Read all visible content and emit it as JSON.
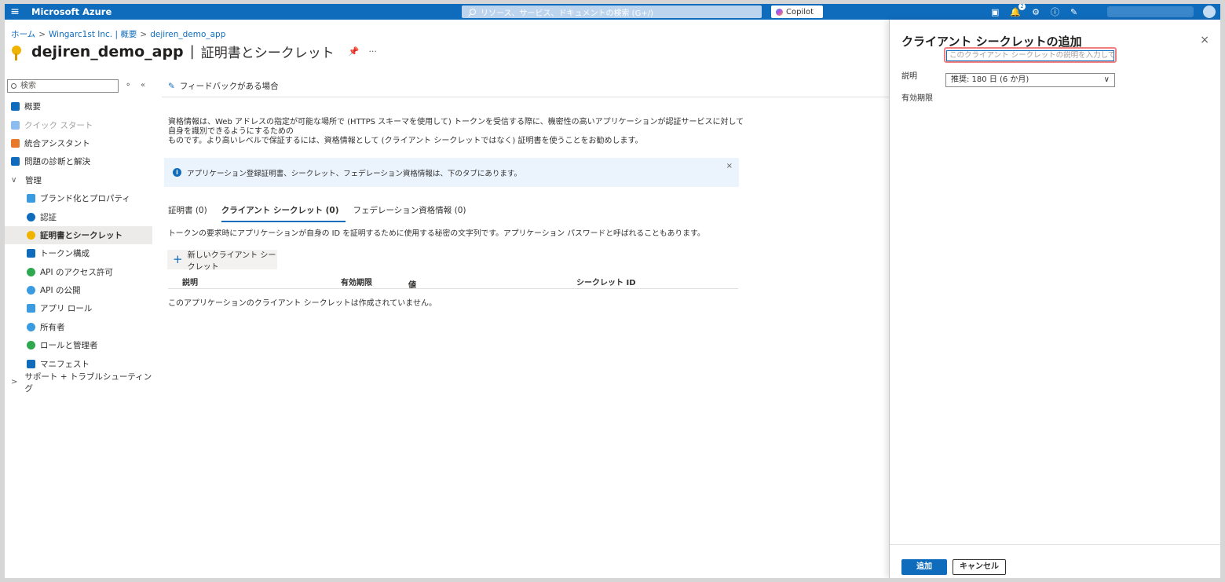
{
  "topbar": {
    "menu_icon": "hamburger-icon",
    "brand": "Microsoft Azure",
    "search_placeholder": "リソース、サービス、ドキュメントの検索 (G+/)",
    "copilot_label": "Copilot",
    "notification_count": "2"
  },
  "breadcrumb": {
    "home": "ホーム",
    "org": "Wingarc1st Inc. | 概要",
    "app": "dejiren_demo_app"
  },
  "title": {
    "app_name": "dejiren_demo_app",
    "separator": "|",
    "page": "証明書とシークレット",
    "more": "···"
  },
  "sidebar": {
    "search_placeholder": "検索",
    "items": [
      {
        "label": "概要",
        "icon": "overview-icon",
        "color": "#0f6cbd"
      },
      {
        "label": "クイック スタート",
        "icon": "quickstart-icon",
        "color": "#8cbdf0"
      },
      {
        "label": "統合アシスタント",
        "icon": "rocket-icon",
        "color": "#e8792b"
      },
      {
        "label": "問題の診断と解決",
        "icon": "wrench-icon",
        "color": "#0f6cbd"
      },
      {
        "label": "管理",
        "icon": "chevron-down-icon"
      },
      {
        "label": "ブランド化とプロパティ",
        "icon": "branding-icon",
        "color": "#3a9be0"
      },
      {
        "label": "認証",
        "icon": "auth-icon",
        "color": "#0f6cbd"
      },
      {
        "label": "証明書とシークレット",
        "icon": "key-icon",
        "color": "#f0b400"
      },
      {
        "label": "トークン構成",
        "icon": "token-icon",
        "color": "#0f6cbd"
      },
      {
        "label": "API のアクセス許可",
        "icon": "api-permission-icon",
        "color": "#2fa84f"
      },
      {
        "label": "API の公開",
        "icon": "cloud-icon",
        "color": "#3a9be0"
      },
      {
        "label": "アプリ ロール",
        "icon": "app-roles-icon",
        "color": "#3a9be0"
      },
      {
        "label": "所有者",
        "icon": "owners-icon",
        "color": "#3a9be0"
      },
      {
        "label": "ロールと管理者",
        "icon": "roles-admins-icon",
        "color": "#2fa84f"
      },
      {
        "label": "マニフェスト",
        "icon": "manifest-icon",
        "color": "#0f6cbd"
      },
      {
        "label": "サポート + トラブルシューティング",
        "icon": "chevron-right-icon"
      }
    ]
  },
  "main": {
    "feedback": "フィードバックがある場合",
    "description_line1": "資格情報は、Web アドレスの指定が可能な場所で (HTTPS スキーマを使用して) トークンを受信する際に、機密性の高いアプリケーションが認証サービスに対して自身を識別できるようにするための",
    "description_line2": "ものです。より高いレベルで保証するには、資格情報として (クライアント シークレットではなく) 証明書を使うことをお勧めします。",
    "info_text": "アプリケーション登録証明書、シークレット、フェデレーション資格情報は、下のタブにあります。",
    "tabs": [
      {
        "label": "証明書 (0)"
      },
      {
        "label": "クライアント シークレット (0)"
      },
      {
        "label": "フェデレーション資格情報 (0)"
      }
    ],
    "tab_description": "トークンの要求時にアプリケーションが自身の ID を証明するために使用する秘密の文字列です。アプリケーション パスワードと呼ばれることもあります。",
    "new_secret_button": "新しいクライアント シークレット",
    "table_headers": {
      "description": "説明",
      "expires": "有効期限",
      "value": "値",
      "secret_id": "シークレット ID"
    },
    "empty_message": "このアプリケーションのクライアント シークレットは作成されていません。"
  },
  "panel": {
    "title": "クライアント シークレットの追加",
    "close": "×",
    "description_label": "説明",
    "description_placeholder": "このクライアント シークレットの説明を入力してください",
    "expiry_label": "有効期限",
    "expiry_value": "推奨: 180 日 (6 か月)",
    "add_button": "追加",
    "cancel_button": "キャンセル"
  },
  "colors": {
    "azure_blue": "#0f6cbd",
    "highlight_red": "#f08080",
    "info_bg": "#ebf3fc"
  }
}
